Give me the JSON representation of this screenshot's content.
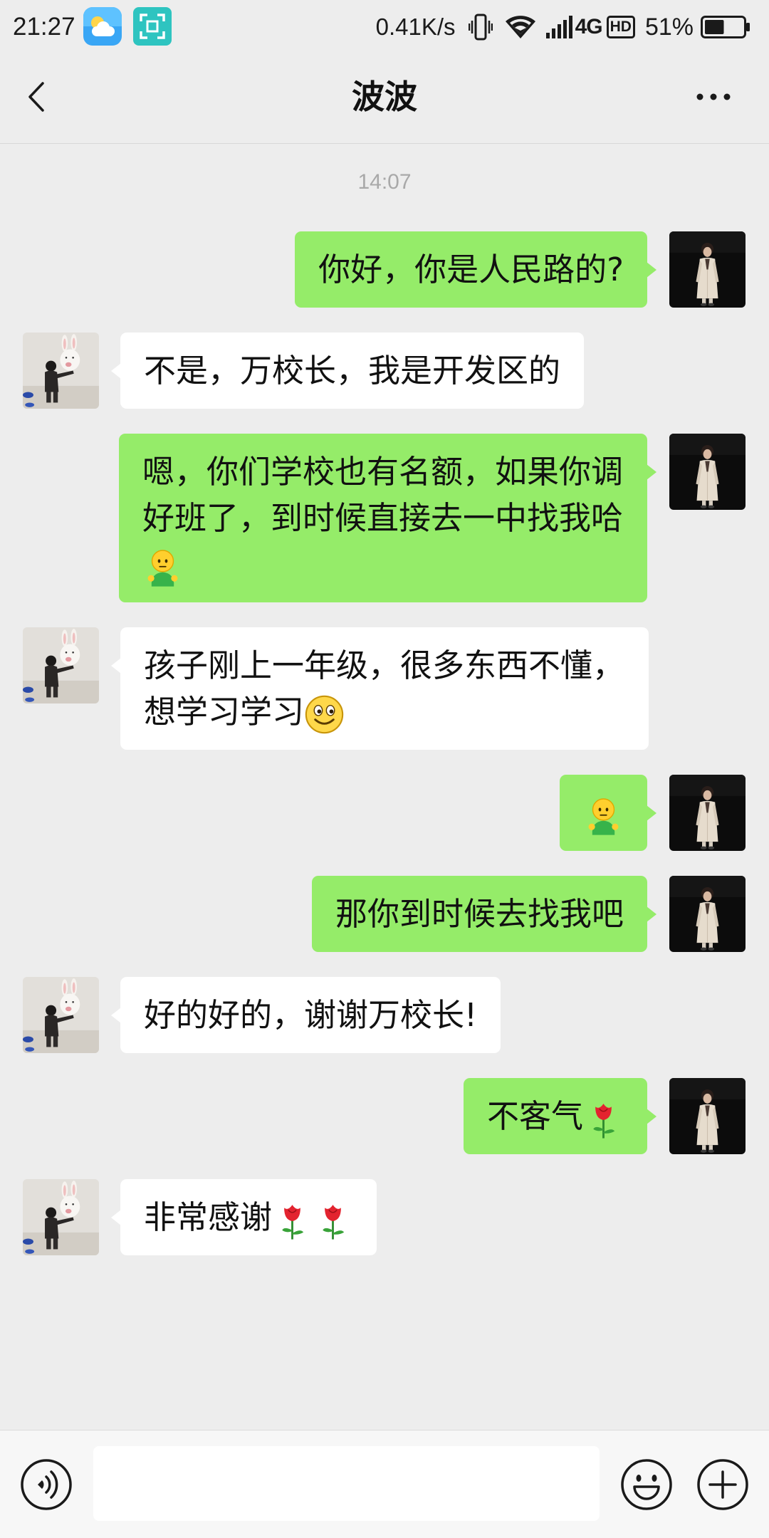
{
  "status_bar": {
    "time": "21:27",
    "notification_icons": [
      "weather-app-icon",
      "scan-app-icon"
    ],
    "network_speed": "0.41K/s",
    "network_type": "4G",
    "hd_badge": "HD",
    "battery_percent": "51%",
    "battery_level": 0.51
  },
  "header": {
    "title": "波波",
    "back_icon": "chevron-left-icon",
    "more_icon": "more-dots-icon"
  },
  "chat": {
    "timestamp": "14:07",
    "messages": [
      {
        "outgoing": true,
        "text": "你好，你是人民路的?",
        "emojis": []
      },
      {
        "outgoing": false,
        "text": "不是，万校长，我是开发区的",
        "emojis": []
      },
      {
        "outgoing": true,
        "text": "嗯，你们学校也有名额，如果你调好班了，到时候直接去一中找我哈",
        "emojis": [
          "person-emoji-icon"
        ]
      },
      {
        "outgoing": false,
        "text": "孩子刚上一年级，很多东西不懂，想学习学习",
        "emojis": [
          "smile-emoji-icon"
        ]
      },
      {
        "outgoing": true,
        "emojis": [
          "person-emoji-icon"
        ]
      },
      {
        "outgoing": true,
        "text": "那你到时候去找我吧",
        "emojis": []
      },
      {
        "outgoing": false,
        "text": "好的好的，谢谢万校长!",
        "emojis": []
      },
      {
        "outgoing": true,
        "text": "不客气",
        "emojis": [
          "rose-emoji-icon"
        ]
      },
      {
        "outgoing": false,
        "text": "非常感谢",
        "emojis": [
          "rose-emoji-icon",
          "rose-emoji-icon"
        ]
      }
    ]
  },
  "input_bar": {
    "voice_icon": "voice-icon",
    "input_value": "",
    "emoji_icon": "emoji-face-icon",
    "plus_icon": "plus-icon"
  },
  "colors": {
    "background": "#ededed",
    "sent_bubble": "#95ec69",
    "received_bubble": "#ffffff",
    "timestamp_text": "#a9a9a9"
  }
}
